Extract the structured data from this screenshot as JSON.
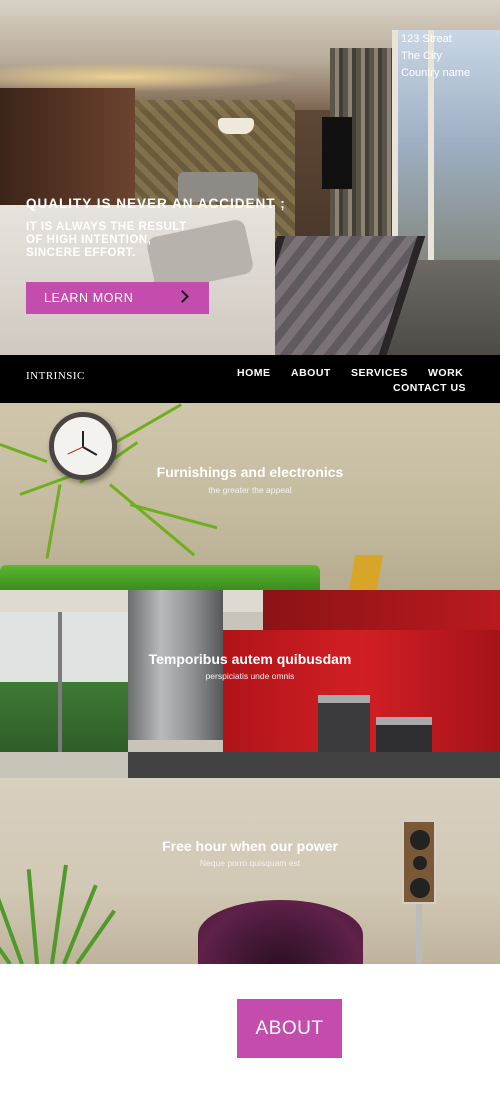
{
  "address": {
    "line1": "123 Streat",
    "line2": "The City",
    "line3": "Country name"
  },
  "hero": {
    "title": "QUALITY IS NEVER AN ACCIDENT ;",
    "subtitle_lines": [
      "IT IS ALWAYS THE RESULT",
      "OF HIGH INTENTION,",
      "SINCERE EFFORT."
    ],
    "button_label": "LEARN MORN",
    "button_icon": "chevron-right-icon"
  },
  "nav": {
    "brand": "INTRINSIC",
    "items": [
      "HOME",
      "ABOUT",
      "SERVICES",
      "WORK",
      "CONTACT US"
    ]
  },
  "panels": [
    {
      "title": "Furnishings and electronics",
      "subtitle": "the greater the appeal"
    },
    {
      "title": "Temporibus autem quibusdam",
      "subtitle": "perspiciatis unde omnis"
    },
    {
      "title": "Free hour when our power",
      "subtitle": "Neque porro quisquam est"
    }
  ],
  "about": {
    "label": "ABOUT"
  },
  "colors": {
    "accent": "#c44cad",
    "nav_bg": "#000000"
  }
}
